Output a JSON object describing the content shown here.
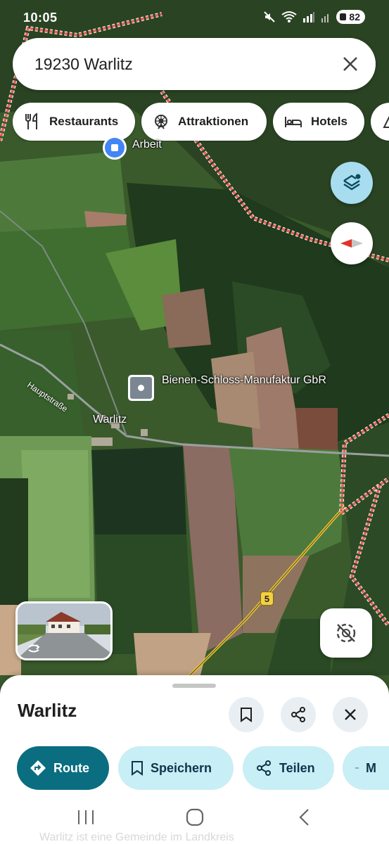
{
  "status_bar": {
    "time": "10:05",
    "battery": "82"
  },
  "search": {
    "query": "19230 Warlitz"
  },
  "chips": [
    {
      "label": "Restaurants",
      "icon": "restaurant-icon"
    },
    {
      "label": "Attraktionen",
      "icon": "attraction-icon"
    },
    {
      "label": "Hotels",
      "icon": "hotel-icon"
    }
  ],
  "map": {
    "work_label": "Arbeit",
    "poi_label": "Bienen-Schloss-Manufaktur GbR",
    "place_label": "Warlitz",
    "street_label": "Hauptstraße",
    "route_number": "5"
  },
  "sheet": {
    "title": "Warlitz",
    "actions": {
      "route": "Route",
      "save": "Speichern",
      "share": "Teilen",
      "more": "M"
    },
    "description": "Warlitz ist eine Gemeinde im Landkreis"
  },
  "colors": {
    "accent": "#0a6e80",
    "secondary_action": "#c8eef6",
    "boundary": "#e8605a"
  }
}
